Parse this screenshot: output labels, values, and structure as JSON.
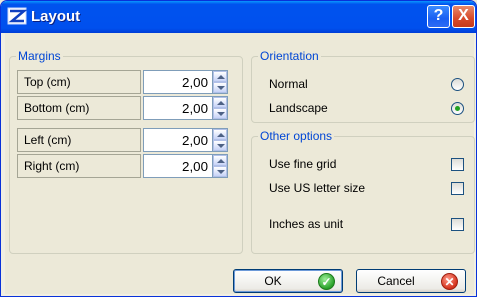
{
  "window": {
    "title": "Layout"
  },
  "titlebar": {
    "help_glyph": "?",
    "close_glyph": "X"
  },
  "margins": {
    "legend": "Margins",
    "rows": [
      {
        "label": "Top (cm)",
        "value": "2,00"
      },
      {
        "label": "Bottom (cm)",
        "value": "2,00"
      },
      {
        "label": "Left (cm)",
        "value": "2,00"
      },
      {
        "label": "Right (cm)",
        "value": "2,00"
      }
    ]
  },
  "orientation": {
    "legend": "Orientation",
    "options": [
      {
        "label": "Normal",
        "selected": false
      },
      {
        "label": "Landscape",
        "selected": true
      }
    ]
  },
  "other": {
    "legend": "Other options",
    "options": [
      {
        "label": "Use fine grid",
        "checked": false
      },
      {
        "label": "Use US letter size",
        "checked": false
      },
      {
        "label": "Inches as unit",
        "checked": false
      }
    ]
  },
  "buttons": {
    "ok_label": "OK",
    "cancel_label": "Cancel"
  },
  "icons": {
    "app": "layout-app-icon",
    "help": "help-icon",
    "close": "close-icon",
    "spin_up": "spin-up-arrow-icon",
    "spin_down": "spin-down-arrow-icon",
    "ok": "green-check-icon",
    "cancel": "red-x-icon"
  },
  "colors": {
    "titlebar": "#0054e3",
    "legend": "#0046d5",
    "dialog_bg": "#ece9d8",
    "radio_dot": "#21a121"
  }
}
